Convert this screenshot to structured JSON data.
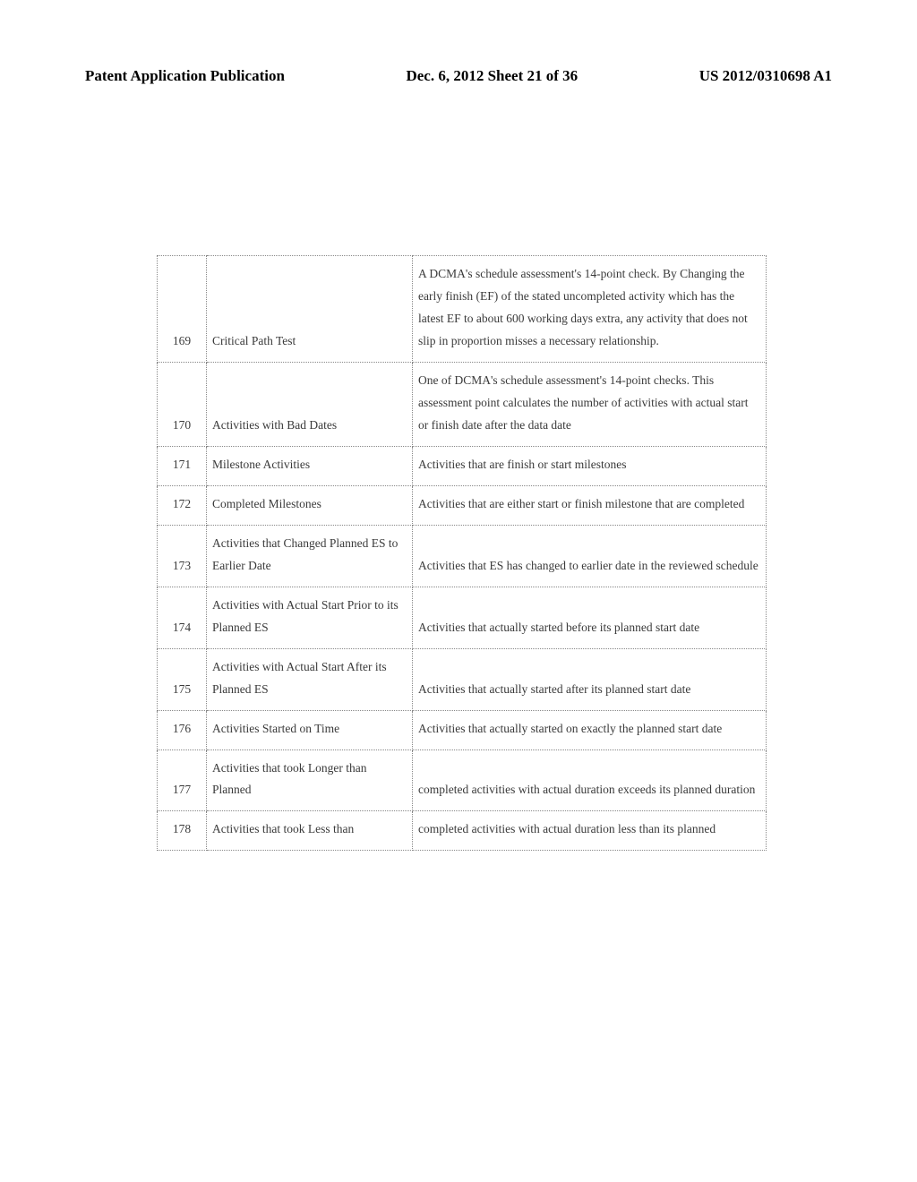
{
  "header": {
    "left": "Patent Application Publication",
    "center": "Dec. 6, 2012  Sheet 21 of 36",
    "right": "US 2012/0310698 A1"
  },
  "rows": [
    {
      "num": "169",
      "name": "Critical Path Test",
      "desc": "A DCMA's schedule assessment's 14-point check.  By Changing the early finish (EF) of the stated uncompleted activity which has the latest EF to about 600 working days extra, any activity that does not slip in proportion misses a necessary relationship."
    },
    {
      "num": "170",
      "name": "Activities with Bad Dates",
      "desc": "One of DCMA's schedule assessment's 14-point checks. This assessment point calculates the number of activities with actual start or finish date after the data date"
    },
    {
      "num": "171",
      "name": "Milestone Activities",
      "desc": "Activities that are finish or start milestones"
    },
    {
      "num": "172",
      "name": "Completed Milestones",
      "desc": "Activities that are either start or finish milestone that are completed"
    },
    {
      "num": "173",
      "name": "Activities that Changed Planned ES to Earlier Date",
      "desc": "Activities that ES has changed to earlier date in the reviewed schedule"
    },
    {
      "num": "174",
      "name": "Activities with Actual Start Prior to its Planned ES",
      "desc": "Activities that actually started before its planned start date"
    },
    {
      "num": "175",
      "name": "Activities with Actual Start After its Planned ES",
      "desc": "Activities that actually started after its planned start date"
    },
    {
      "num": "176",
      "name": "Activities Started on Time",
      "desc": "Activities that actually started on exactly the planned start date"
    },
    {
      "num": "177",
      "name": "Activities that took Longer than Planned",
      "desc": "completed activities with actual duration exceeds its planned duration"
    },
    {
      "num": "178",
      "name": "Activities that took Less than",
      "desc": "completed activities with actual duration less than its planned"
    }
  ]
}
